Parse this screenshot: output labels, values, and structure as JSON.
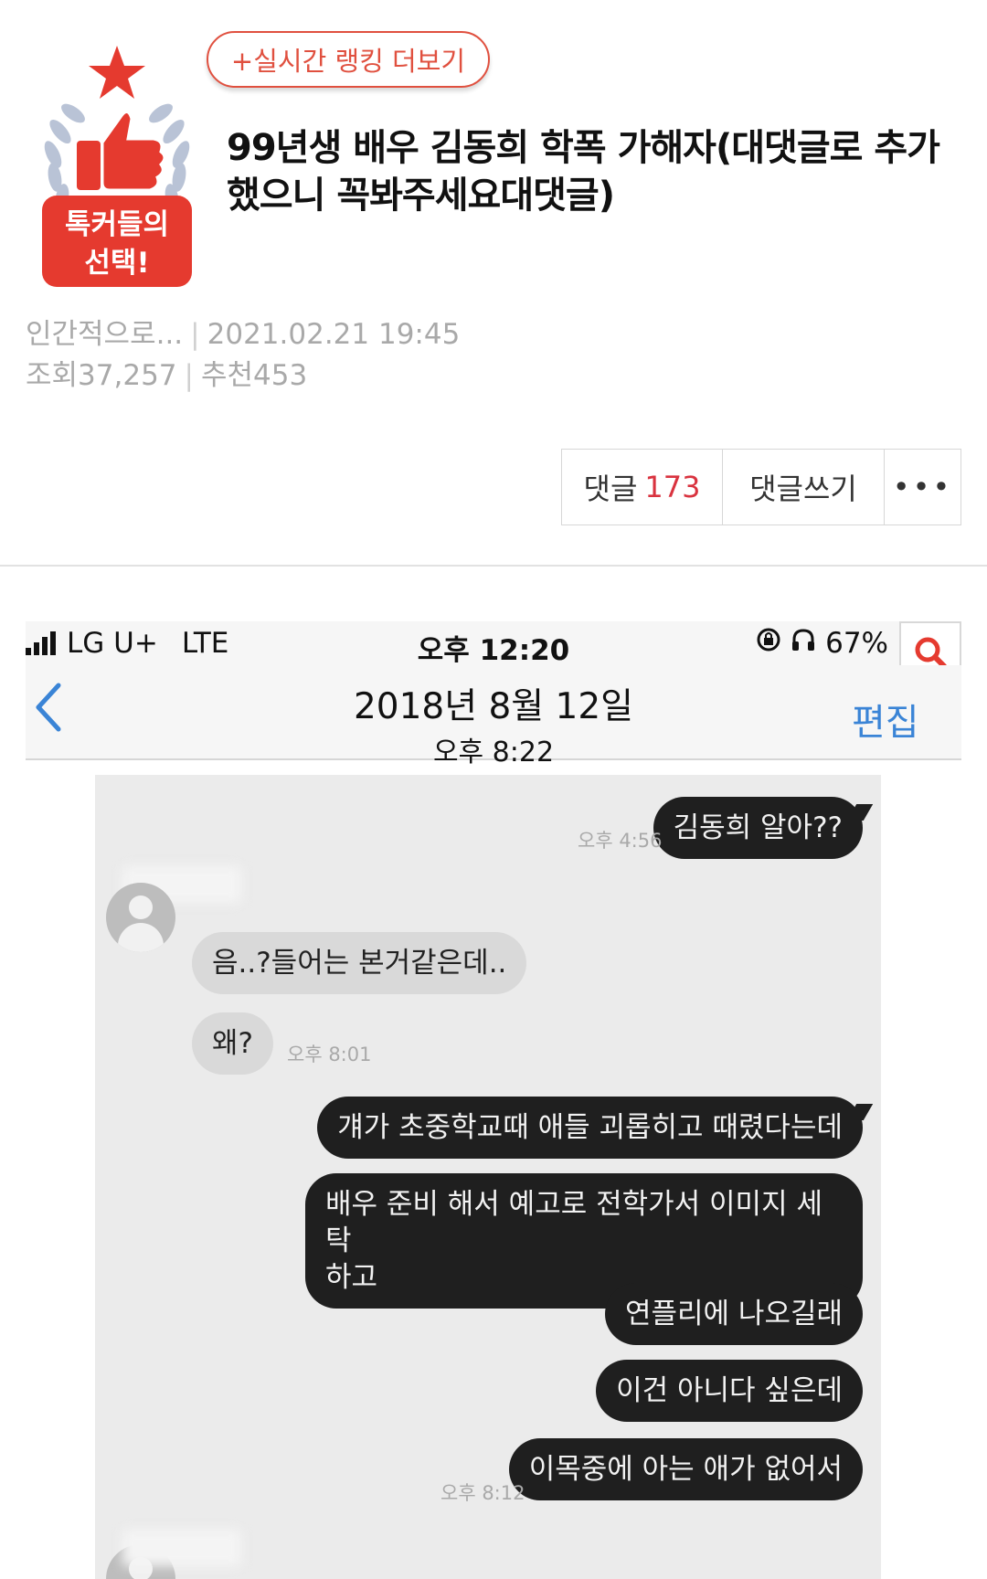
{
  "badge": {
    "line1": "톡커들의",
    "line2": "선택!"
  },
  "ranking_button": "+실시간 랭킹 더보기",
  "post": {
    "title": "99년생 배우 김동희 학폭 가해자(대댓글로 추가했으니 꼭봐주세요대댓글)",
    "author": "인간적으로...",
    "datetime": "2021.02.21 19:45",
    "views": "조회37,257",
    "recommends": "추천453"
  },
  "actions": {
    "comments_label": "댓글",
    "comments_count": "173",
    "write_label": "댓글쓰기",
    "more_label": "•••"
  },
  "screenshot": {
    "status": {
      "carrier": "LG U+",
      "network": "LTE",
      "time": "오후 12:20",
      "battery": "67%"
    },
    "nav": {
      "date": "2018년 8월 12일",
      "time": "오후 8:22",
      "edit": "편집"
    },
    "messages": [
      {
        "dir": "out",
        "text": "김동희 알아??",
        "time": "오후 4:56"
      },
      {
        "dir": "in",
        "text": "음..?들어는 본거같은데.."
      },
      {
        "dir": "in",
        "text": "왜?",
        "time": "오후 8:01"
      },
      {
        "dir": "out",
        "text": "걔가 초중학교때 애들 괴롭히고 때렸다는데"
      },
      {
        "dir": "out",
        "text": "배우 준비 해서 예고로 전학가서 이미지 세탁",
        "text2": "하고"
      },
      {
        "dir": "out",
        "text": "연플리에 나오길래"
      },
      {
        "dir": "out",
        "text": "이건 아니다 싶은데"
      },
      {
        "dir": "out",
        "text": "이목중에 아는 애가 없어서",
        "time": "오후 8:12"
      }
    ]
  }
}
